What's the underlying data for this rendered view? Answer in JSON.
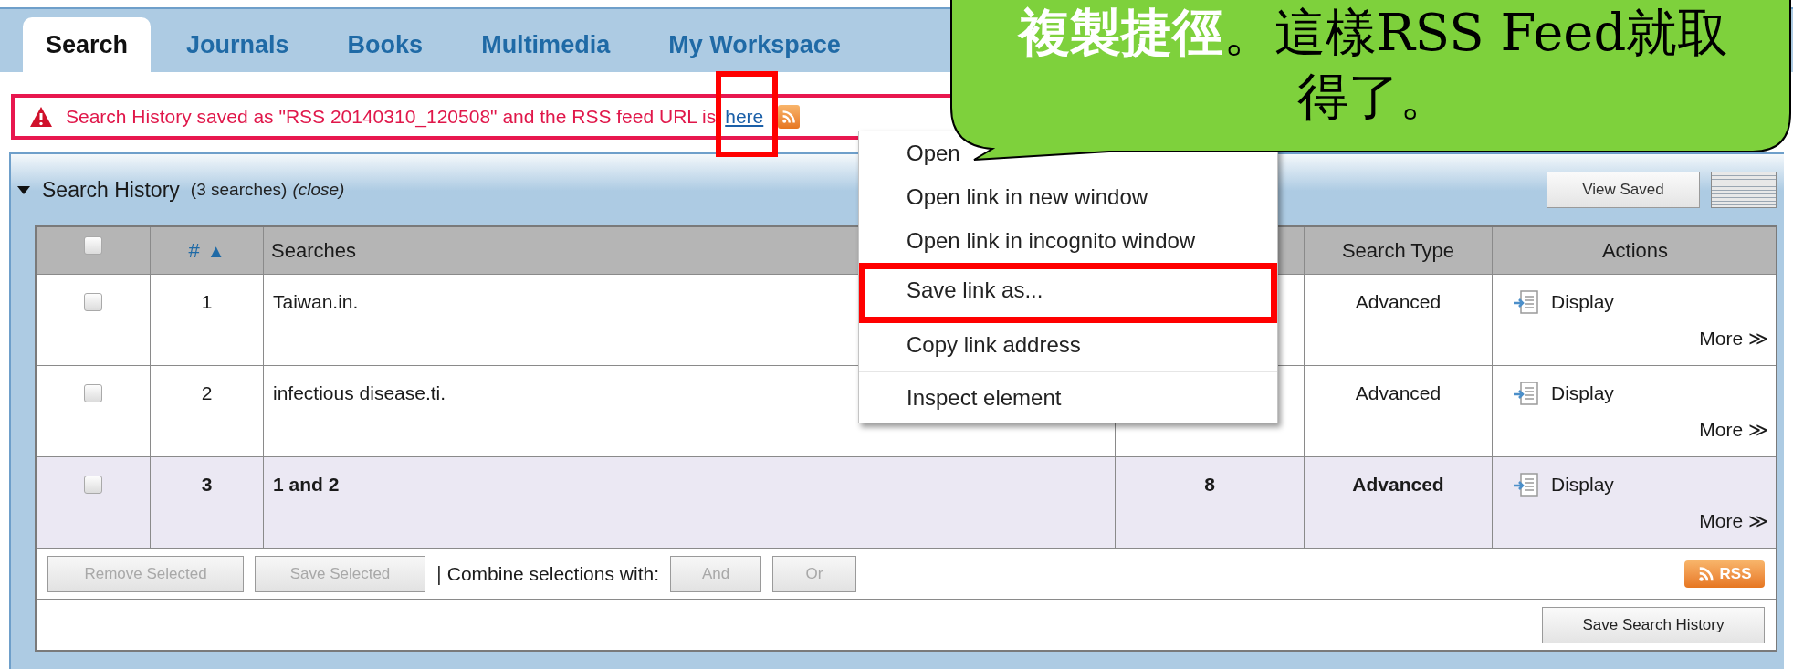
{
  "tabs": [
    {
      "label": "Search",
      "selected": true
    },
    {
      "label": "Journals",
      "selected": false
    },
    {
      "label": "Books",
      "selected": false
    },
    {
      "label": "Multimedia",
      "selected": false
    },
    {
      "label": "My Workspace",
      "selected": false
    }
  ],
  "alert": {
    "message": "Search History saved as \"RSS 20140310_120508\" and the RSS feed URL is",
    "link": {
      "label": "here",
      "highlighted": true
    }
  },
  "panel": {
    "title": "Search History",
    "expanded": true,
    "count": "(3 searches)",
    "close_link": "(close)",
    "view_saved": "View Saved"
  },
  "table": {
    "header_checkbox": {
      "checked": false
    },
    "columns": [
      {
        "kind": "checkbox"
      },
      {
        "kind": "sort",
        "label": "#",
        "sort_arrow": "▲"
      },
      {
        "kind": "text",
        "label": "Searches"
      },
      {
        "kind": "hidden"
      },
      {
        "kind": "text",
        "label": "Search Type"
      },
      {
        "kind": "text",
        "label": "Actions"
      }
    ],
    "rows": [
      {
        "checked": false,
        "highlighted": false,
        "number": "1",
        "query": "Taiwan.in.",
        "type": "Advanced",
        "display": "Display",
        "more": "More ≫"
      },
      {
        "checked": false,
        "highlighted": false,
        "number": "2",
        "query": "infectious disease.ti.",
        "type": "Advanced",
        "display": "Display",
        "more": "More ≫"
      },
      {
        "checked": false,
        "highlighted": true,
        "number": "3",
        "query": "1 and 2",
        "results": "8",
        "type": "Advanced",
        "display": "Display",
        "more": "More ≫"
      }
    ],
    "action_buttons": [
      {
        "label": "Remove Selected",
        "disabled": true
      },
      {
        "label": "Save Selected",
        "disabled": true
      }
    ],
    "separator": "|",
    "combine_label": "Combine selections with:",
    "combine_buttons": [
      {
        "label": "And",
        "disabled": true
      },
      {
        "label": "Or",
        "disabled": true
      }
    ],
    "rss": "RSS",
    "save_history": "Save Search History"
  },
  "context_menu": {
    "items": [
      {
        "kind": "item",
        "label": "Open",
        "highlighted": false
      },
      {
        "kind": "item",
        "label": "Open link in new window",
        "highlighted": false
      },
      {
        "kind": "item",
        "label": "Open link in incognito window",
        "highlighted": false
      },
      {
        "kind": "item",
        "label": "Save link as...",
        "highlighted": true
      },
      {
        "kind": "item",
        "label": "Copy link address",
        "highlighted": false
      },
      {
        "kind": "separator"
      },
      {
        "kind": "item",
        "label": "Inspect element",
        "highlighted": false
      }
    ]
  },
  "callout": {
    "lines": [
      "**複製捷徑**。這樣RSS Feed就取",
      "得了。"
    ]
  }
}
